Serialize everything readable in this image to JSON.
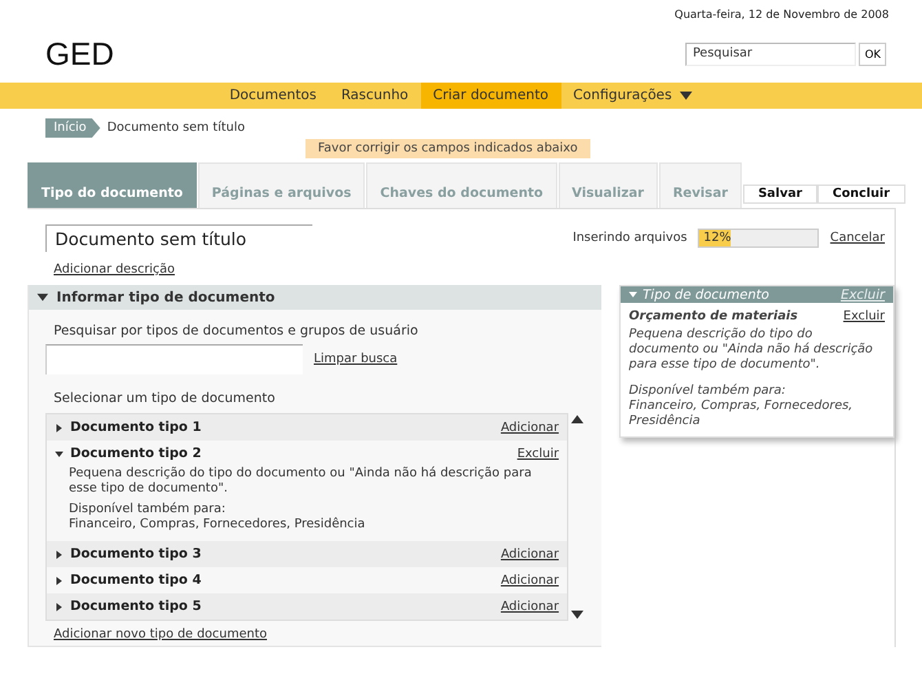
{
  "date": "Quarta-feira, 12 de Novembro de 2008",
  "logo": "GED",
  "search": {
    "placeholder": "Pesquisar",
    "button": "OK"
  },
  "nav": [
    {
      "label": "Documentos",
      "selected": false,
      "dropdown": false
    },
    {
      "label": "Rascunho",
      "selected": false,
      "dropdown": false
    },
    {
      "label": "Criar documento",
      "selected": true,
      "dropdown": false
    },
    {
      "label": "Configurações",
      "selected": false,
      "dropdown": true
    }
  ],
  "breadcrumb": [
    "Início",
    "Documento sem título"
  ],
  "alert": "Favor corrigir os campos indicados abaixo",
  "tabs": [
    {
      "label": "Tipo do documento",
      "selected": true
    },
    {
      "label": "Páginas e arquivos",
      "selected": false
    },
    {
      "label": "Chaves do documento",
      "selected": false
    },
    {
      "label": "Visualizar",
      "selected": false
    },
    {
      "label": "Revisar",
      "selected": false
    }
  ],
  "actions": [
    "Salvar",
    "Concluir"
  ],
  "document": {
    "title": "Documento sem título",
    "add_description": "Adicionar descrição"
  },
  "upload": {
    "label": "Inserindo arquivos",
    "level": 0.26,
    "reading": "12%",
    "cancel": "Cancelar"
  },
  "type_section": {
    "title": "Informar tipo de documento",
    "expanded": true,
    "search_label": "Pesquisar por tipos de documentos e grupos de usuário",
    "clear": "Limpar busca",
    "select_label": "Selecionar um tipo de documento",
    "items": [
      {
        "name": "Documento tipo 1",
        "expanded": false,
        "action": "Adicionar"
      },
      {
        "name": "Documento tipo 2",
        "expanded": true,
        "action": "Excluir",
        "description": "Pequena descrição do tipo do documento ou \"Ainda não há descrição para esse tipo de documento\".",
        "available_label": "Disponível também para:",
        "available": "Financeiro, Compras, Fornecedores, Presidência"
      },
      {
        "name": "Documento tipo 3",
        "expanded": false,
        "action": "Adicionar"
      },
      {
        "name": "Documento tipo 4",
        "expanded": false,
        "action": "Adicionar"
      },
      {
        "name": "Documento tipo 5",
        "expanded": false,
        "action": "Adicionar"
      }
    ],
    "add_new": "Adicionar novo tipo de documento"
  },
  "side_panel": {
    "title": "Tipo de documento",
    "expanded": true,
    "remove": "Excluir",
    "item": {
      "name": "Orçamento de materiais",
      "remove": "Excluir",
      "description": "Pequena descrição do tipo do documento ou \"Ainda não há descrição para esse tipo de documento\".",
      "available_label": "Disponível também para:",
      "available": "Financeiro, Compras, Fornecedores, Presidência"
    }
  }
}
